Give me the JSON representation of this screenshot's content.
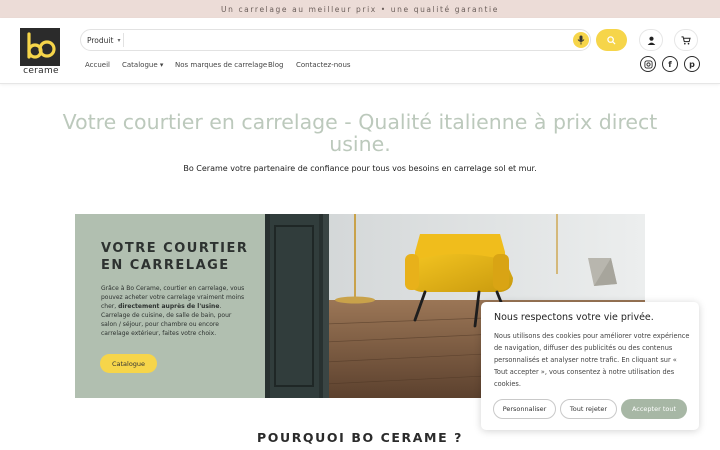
{
  "topbar": {
    "text": "Un carrelage au meilleur prix • une qualité garantie"
  },
  "brand": {
    "name": "cerame"
  },
  "search": {
    "category": "Produit",
    "placeholder": ""
  },
  "nav": [
    {
      "label": "Accueil"
    },
    {
      "label": "Catalogue ▾"
    },
    {
      "label": "Nos marques de carrelage"
    },
    {
      "label": "Blog"
    },
    {
      "label": "Contactez-nous"
    }
  ],
  "hero": {
    "title_line1": "Votre courtier en carrelage - Qualité italienne à prix direct",
    "title_line2": "usine.",
    "subtitle": "Bo Cerame votre partenaire de confiance pour tous vos besoins en carrelage sol et mur."
  },
  "promo": {
    "title_line1": "VOTRE COURTIER",
    "title_line2": "EN CARRELAGE",
    "text_before": "Grâce à Bo Cerame, courtier en carrelage, vous pouvez acheter votre carrelage vraiment moins cher, ",
    "text_bold": "directement auprès de l'usine",
    "text_after": ". Carrelage de cuisine, de salle de bain, pour salon / séjour, pour chambre ou encore carrelage extérieur, faites votre choix.",
    "button": "Catalogue"
  },
  "section": {
    "why_title": "POURQUOI BO CERAME ?"
  },
  "cookie": {
    "title": "Nous respectons votre vie privée.",
    "text": "Nous utilisons des cookies pour améliorer votre expérience de navigation, diffuser des publicités ou des contenus personnalisés et analyser notre trafic. En cliquant sur « Tout accepter », vous consentez à notre utilisation des cookies.",
    "customize": "Personnaliser",
    "reject": "Tout rejeter",
    "accept": "Accepter tout"
  },
  "colors": {
    "accent_yellow": "#f6d54a",
    "sage": "#b1bfb0",
    "topbar": "#ecdcd7",
    "accept_button": "#a7b7a5"
  },
  "icons": [
    "logo-mark",
    "chevron-down-icon",
    "microphone-icon",
    "search-icon",
    "user-icon",
    "cart-icon",
    "instagram-icon",
    "facebook-icon",
    "pinterest-icon"
  ]
}
